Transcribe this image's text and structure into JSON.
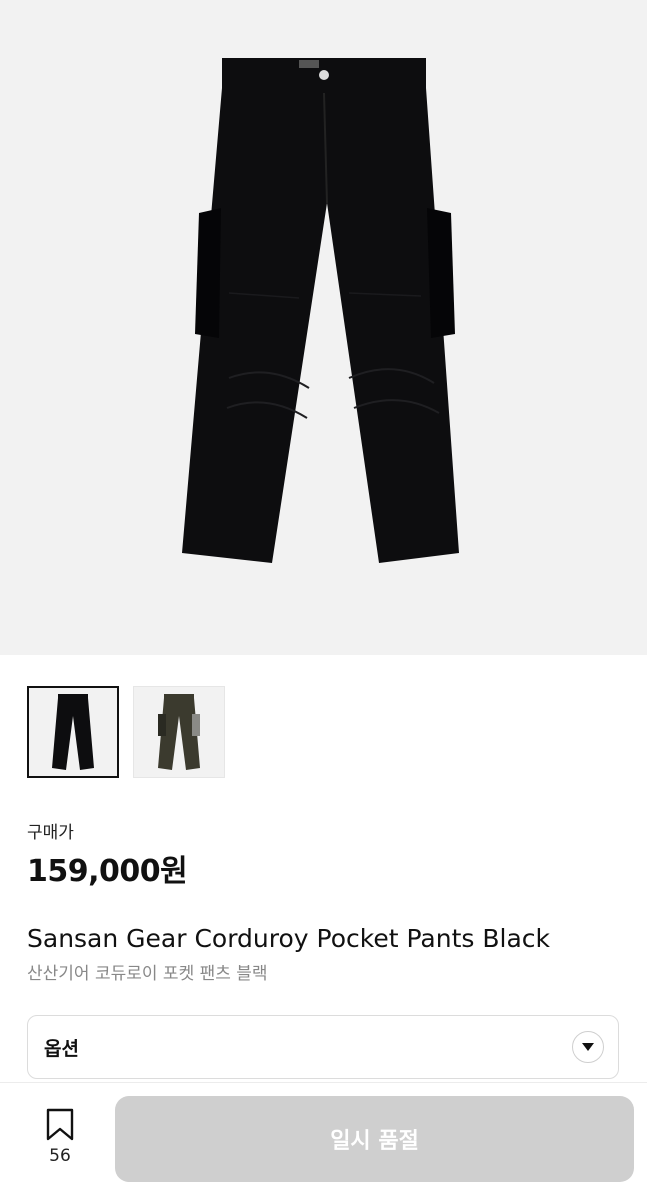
{
  "product": {
    "images": [
      {
        "name": "black-pants-image",
        "color": "#0d0d0f"
      },
      {
        "name": "khaki-pants-image",
        "color": "#3b3a2e"
      }
    ],
    "price_label": "구매가",
    "price": "159,000원",
    "title_en": "Sansan Gear Corduroy Pocket Pants Black",
    "title_ko": "산산기어 코듀로이 포켓 팬츠 블랙"
  },
  "option": {
    "label": "옵션",
    "icon": "chevron-down-icon"
  },
  "bottom_bar": {
    "wishlist_icon": "bookmark-icon",
    "wishlist_count": "56",
    "action_label": "일시 품절"
  },
  "colors": {
    "hero_bg": "#f2f2f2",
    "disabled_button": "#cfcfcf",
    "text_secondary": "#888888"
  }
}
